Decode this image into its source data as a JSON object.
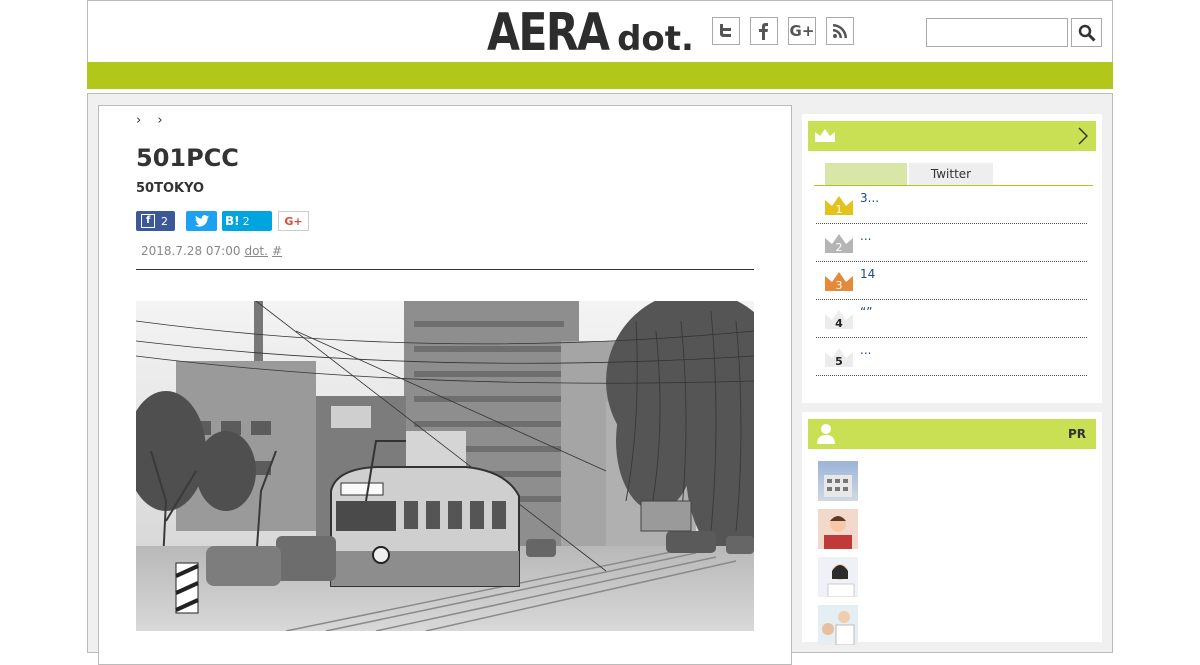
{
  "header": {
    "logo_main": "AERA",
    "logo_sub_d": "d",
    "logo_sub_rest": "ot.",
    "social": [
      {
        "icon": "twitter-icon"
      },
      {
        "icon": "facebook-icon"
      },
      {
        "icon": "google-plus-icon"
      },
      {
        "icon": "rss-icon"
      }
    ],
    "search_value": ""
  },
  "colors": {
    "accent": "#b1c81a",
    "sidebar_head": "#c9e054",
    "link": "#1e4c8a"
  },
  "article": {
    "breadcrumb": "› ›",
    "title": "501PCC",
    "subtitle": "50TOKYO",
    "share": {
      "facebook_count": "2",
      "hatena_label": "B!",
      "hatena_count": "2",
      "gplus_label": "G+"
    },
    "date": "2018.7.28 07:00",
    "source": "dot.",
    "hash": "#"
  },
  "ranking": {
    "tabs": [
      "",
      "Twitter"
    ],
    "items": [
      {
        "rank": "1",
        "text": "3..."
      },
      {
        "rank": "2",
        "text": "..."
      },
      {
        "rank": "3",
        "text": "14"
      },
      {
        "rank": "4",
        "text": "“”"
      },
      {
        "rank": "5",
        "text": "..."
      }
    ]
  },
  "pr": {
    "label": "PR"
  }
}
